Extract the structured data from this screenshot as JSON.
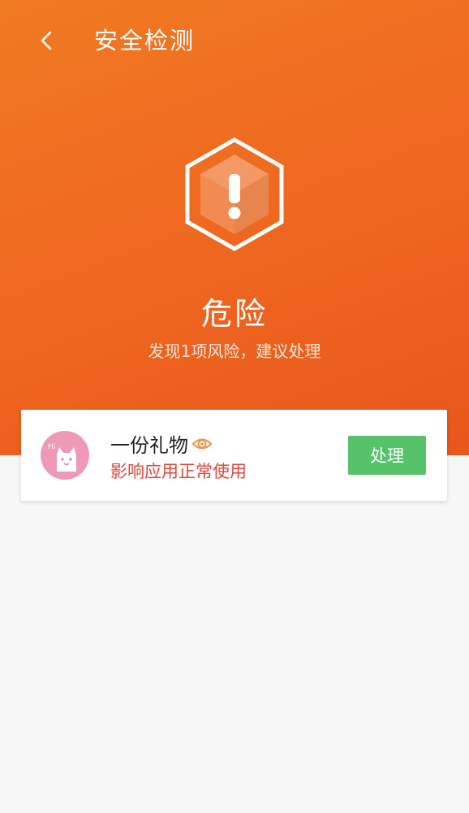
{
  "header": {
    "title": "安全检测",
    "accent_color": "#ef6a20",
    "back_icon": "chevron-left-icon"
  },
  "status": {
    "icon": "warning-hexagon-icon",
    "title": "危险",
    "subtitle": "发现1项风险，建议处理"
  },
  "risk_items": [
    {
      "app_name": "一份礼物",
      "avatar_icon": "cat-avatar-icon",
      "badge_icon": "eye-icon",
      "description": "影响应用正常使用",
      "description_color": "#e0463c",
      "action_label": "处理",
      "action_color": "#56c26a"
    }
  ]
}
